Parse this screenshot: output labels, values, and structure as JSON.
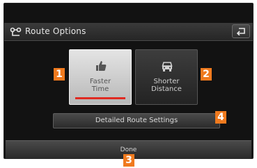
{
  "header": {
    "title": "Route Options",
    "title_icon": "route-options-icon",
    "back_icon": "back-icon"
  },
  "options": [
    {
      "line1": "Faster",
      "line2": "Time",
      "icon": "thumbs-up-icon",
      "selected": true
    },
    {
      "line1": "Shorter",
      "line2": "Distance",
      "icon": "car-icon",
      "selected": false
    }
  ],
  "detail_button": {
    "label": "Detailed Route Settings"
  },
  "done_button": {
    "label": "Done"
  },
  "callouts": [
    "1",
    "2",
    "3",
    "4"
  ],
  "colors": {
    "accent_red": "#e02a22",
    "callout_orange": "#f07a1e",
    "screen_bg": "#121212"
  }
}
